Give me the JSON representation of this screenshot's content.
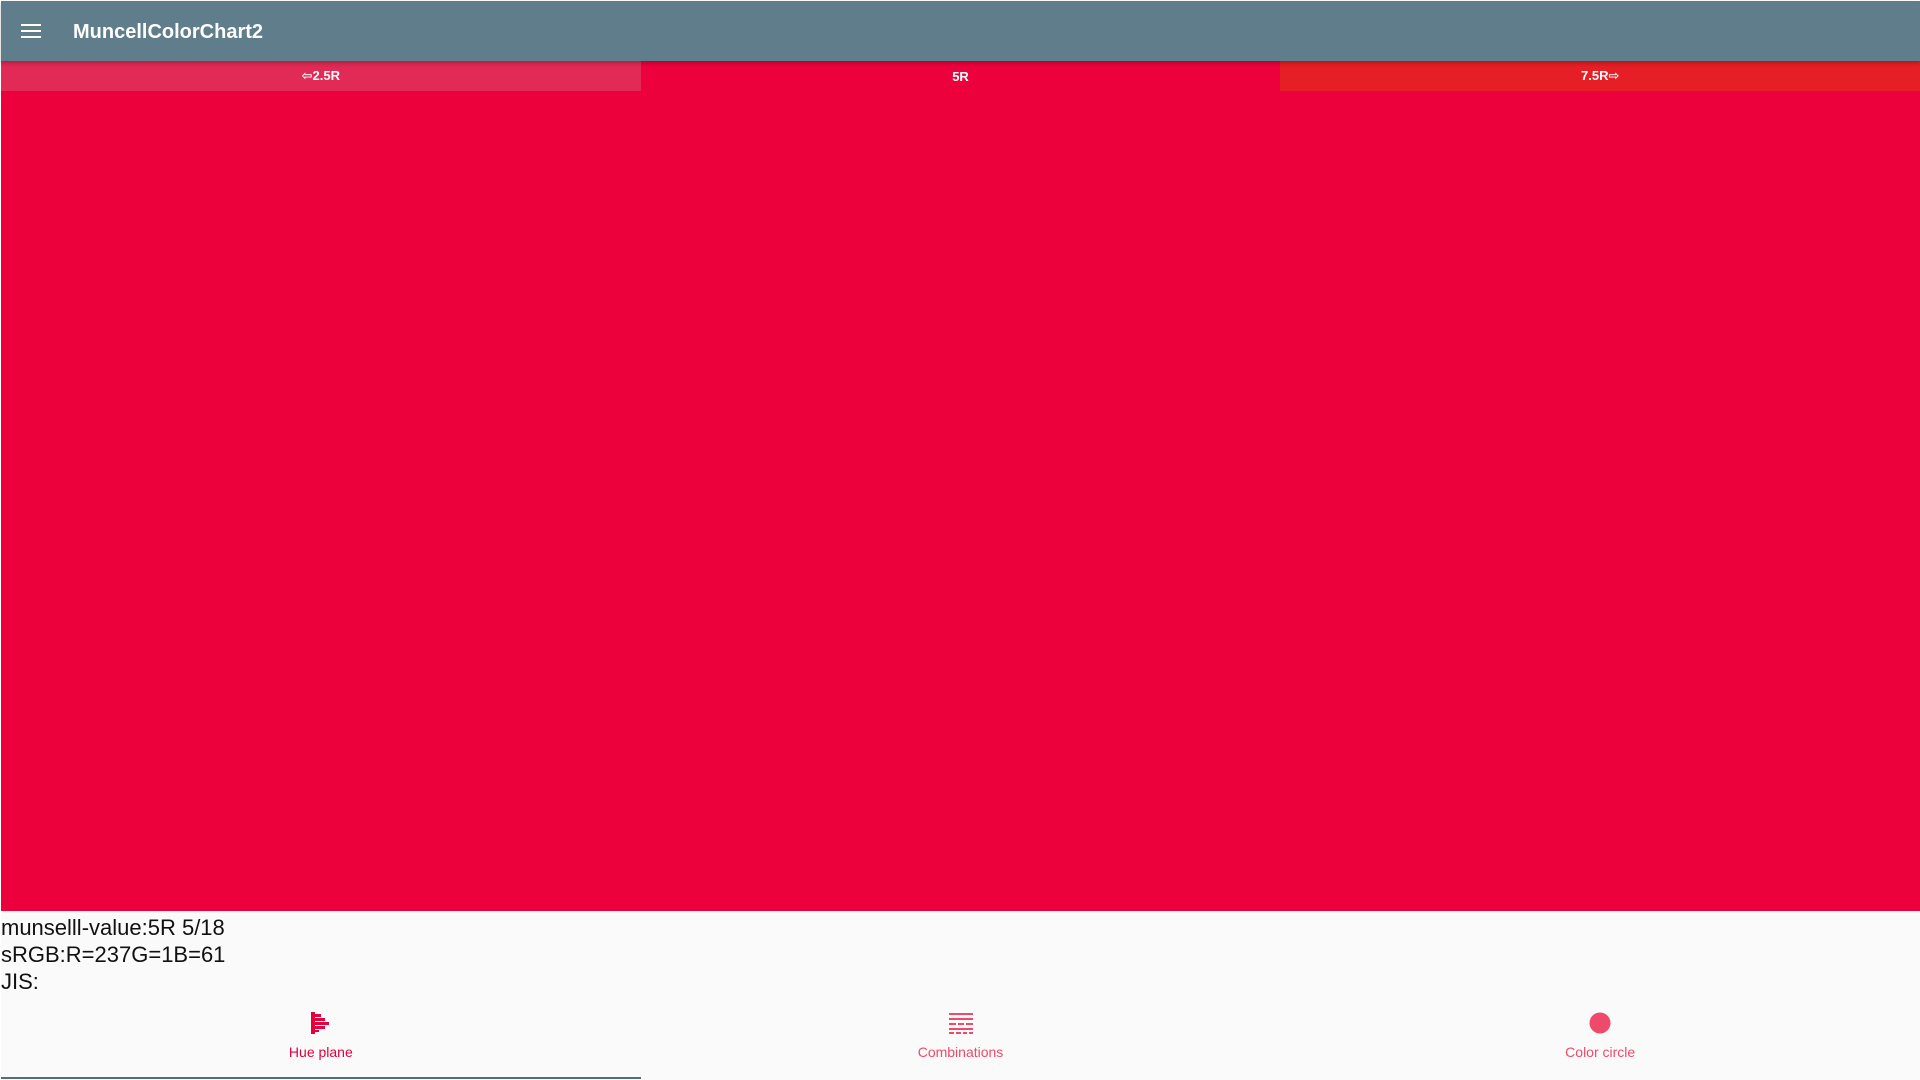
{
  "app": {
    "title": "MuncellColorChart2",
    "menu_icon": "hamburger-menu-icon"
  },
  "hue_tabs": [
    {
      "label": "⇦2.5R",
      "color": "#e12a55"
    },
    {
      "label": "5R",
      "color": "#ed013d"
    },
    {
      "label": "7.5R⇨",
      "color": "#e61e26"
    }
  ],
  "swatch": {
    "color": "#ed013d"
  },
  "info": {
    "munsell": "munselll-value:5R 5/18",
    "srgb": "sRGB:R=237G=1B=61",
    "jis": "JIS:"
  },
  "bottom_nav": {
    "accent_color": "#e4003a",
    "items": [
      {
        "label": "Hue plane",
        "icon": "hue-plane-icon",
        "active": true
      },
      {
        "label": "Combinations",
        "icon": "combinations-icon",
        "active": false
      },
      {
        "label": "Color circle",
        "icon": "color-circle-icon",
        "active": false
      }
    ]
  }
}
